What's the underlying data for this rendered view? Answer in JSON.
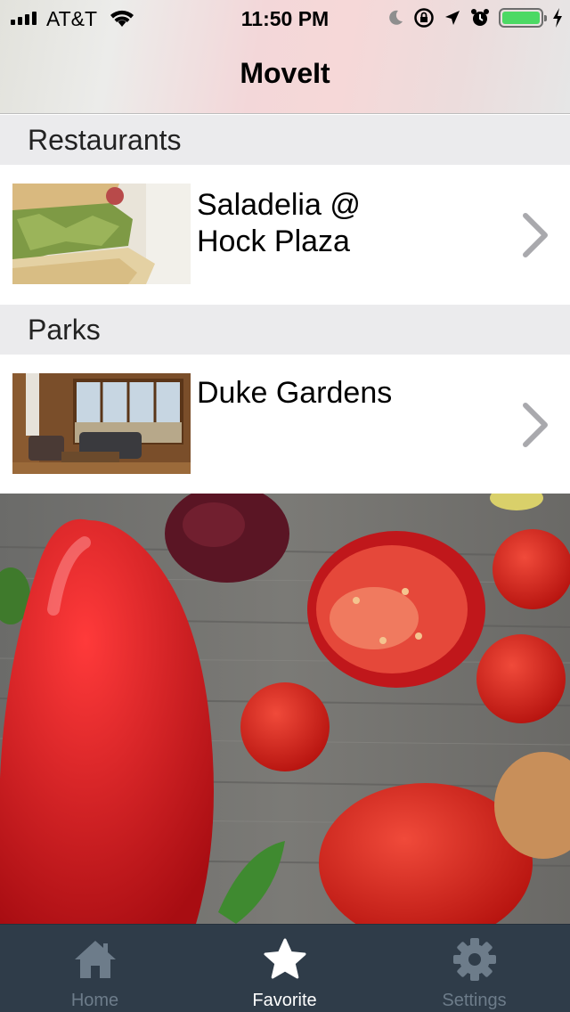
{
  "status_bar": {
    "carrier": "AT&T",
    "time": "11:50 PM",
    "battery_color": "#4cd964"
  },
  "nav": {
    "title": "MoveIt"
  },
  "sections": [
    {
      "title": "Restaurants",
      "rows": [
        {
          "title_line1": "Saladelia @",
          "title_line2": "Hock Plaza",
          "image": "sandwich-photo"
        }
      ]
    },
    {
      "title": "Parks",
      "rows": [
        {
          "title_line1": "Duke Gardens",
          "image": "lodge-interior-photo"
        }
      ]
    }
  ],
  "background": {
    "image": "vegetables-on-wood-photo"
  },
  "tabbar": {
    "background": "#2f3c49",
    "tabs": [
      {
        "label": "Home",
        "icon": "home-icon",
        "active": false
      },
      {
        "label": "Favorite",
        "icon": "star-icon",
        "active": true
      },
      {
        "label": "Settings",
        "icon": "gear-icon",
        "active": false
      }
    ]
  }
}
